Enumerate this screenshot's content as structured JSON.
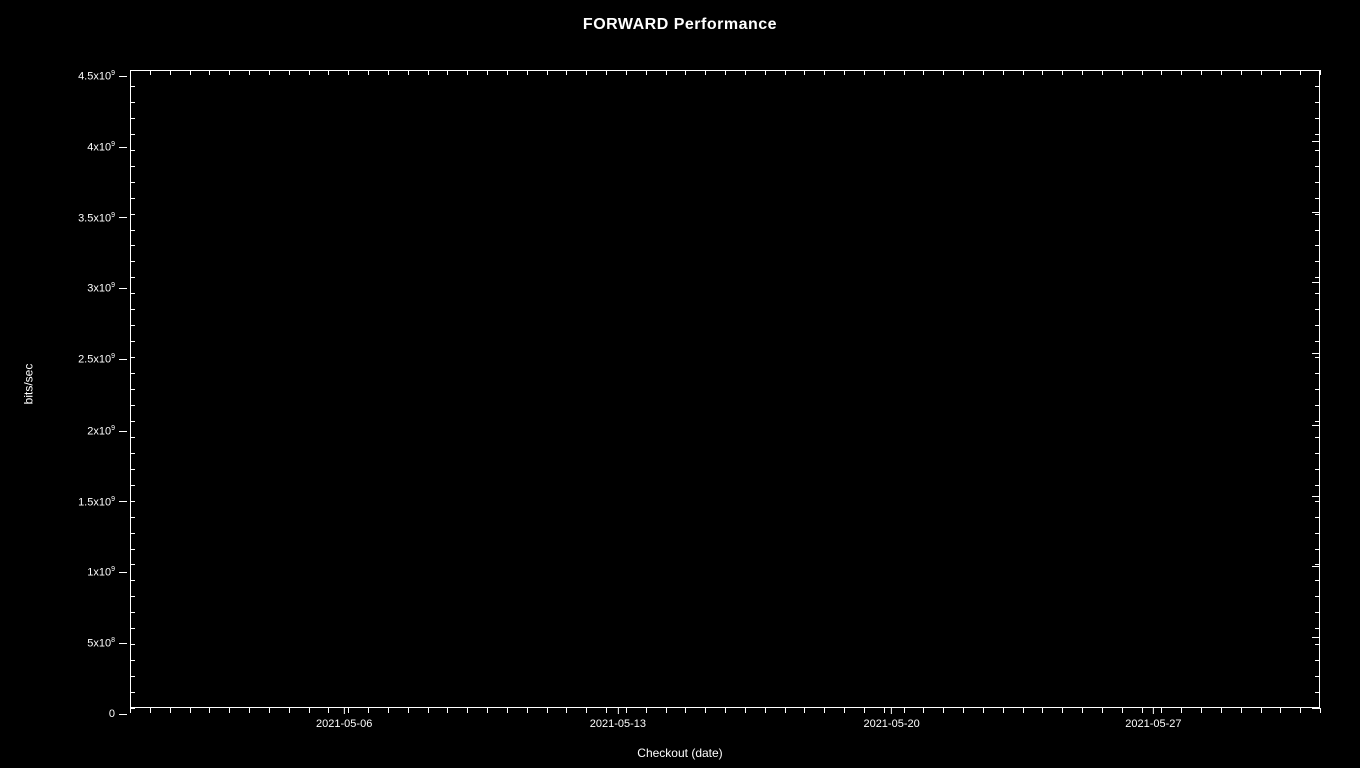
{
  "chart": {
    "title": "FORWARD Performance",
    "x_axis_label": "Checkout (date)",
    "y_axis_label": "bits/sec",
    "y_ticks": [
      {
        "value": "4.5x10",
        "exp": "9",
        "pct": 100
      },
      {
        "value": "4x10",
        "exp": "9",
        "pct": 88.9
      },
      {
        "value": "3.5x10",
        "exp": "9",
        "pct": 77.8
      },
      {
        "value": "3x10",
        "exp": "9",
        "pct": 66.7
      },
      {
        "value": "2.5x10",
        "exp": "9",
        "pct": 55.6
      },
      {
        "value": "2x10",
        "exp": "9",
        "pct": 44.4
      },
      {
        "value": "1.5x10",
        "exp": "9",
        "pct": 33.3
      },
      {
        "value": "1x10",
        "exp": "9",
        "pct": 22.2
      },
      {
        "value": "5x10",
        "exp": "8",
        "pct": 11.1
      },
      {
        "value": "0",
        "exp": "",
        "pct": 0
      }
    ],
    "x_ticks": [
      {
        "label": "2021-05-06",
        "pct": 18
      },
      {
        "label": "2021-05-13",
        "pct": 41
      },
      {
        "label": "2021-05-20",
        "pct": 64
      },
      {
        "label": "2021-05-27",
        "pct": 86
      }
    ]
  }
}
